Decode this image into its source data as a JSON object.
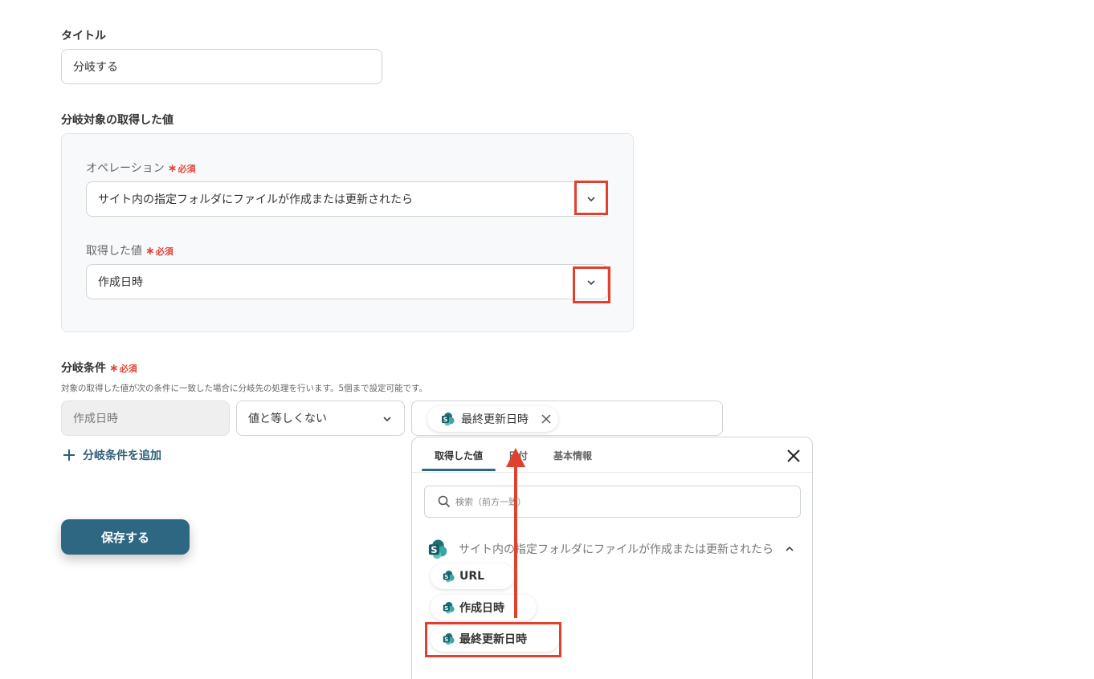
{
  "title_field": {
    "label": "タイトル",
    "value": "分岐する"
  },
  "target_section": {
    "label": "分岐対象の取得した値",
    "operation": {
      "label": "オペレーション",
      "required": "必須",
      "value": "サイト内の指定フォルダにファイルが作成または更新されたら"
    },
    "acquired_value": {
      "label": "取得した値",
      "required": "必須",
      "value": "作成日時"
    }
  },
  "condition_section": {
    "label": "分岐条件",
    "required": "必須",
    "help": "対象の取得した値が次の条件に一致した場合に分岐先の処理を行います。5個まで設定可能です。",
    "field_value": "作成日時",
    "operator": "値と等しくない",
    "chip_label": "最終更新日時",
    "add_label": "分岐条件を追加"
  },
  "save_label": "保存する",
  "picker": {
    "tabs": [
      {
        "label": "取得した値",
        "active": true
      },
      {
        "label": "日付",
        "active": false
      },
      {
        "label": "基本情報",
        "active": false
      }
    ],
    "search_placeholder": "検索（前方一致）",
    "group_label": "サイト内の指定フォルダにファイルが作成または更新されたら",
    "items": [
      "URL",
      "作成日時",
      "最終更新日時"
    ]
  },
  "colors": {
    "accent": "#2e6782",
    "highlight": "#e0402f",
    "sharepoint_teal": "#2a8a8c"
  },
  "icons": [
    "chevron-down-icon",
    "close-icon",
    "search-icon",
    "plus-icon",
    "sharepoint-icon",
    "chevron-up-icon"
  ]
}
